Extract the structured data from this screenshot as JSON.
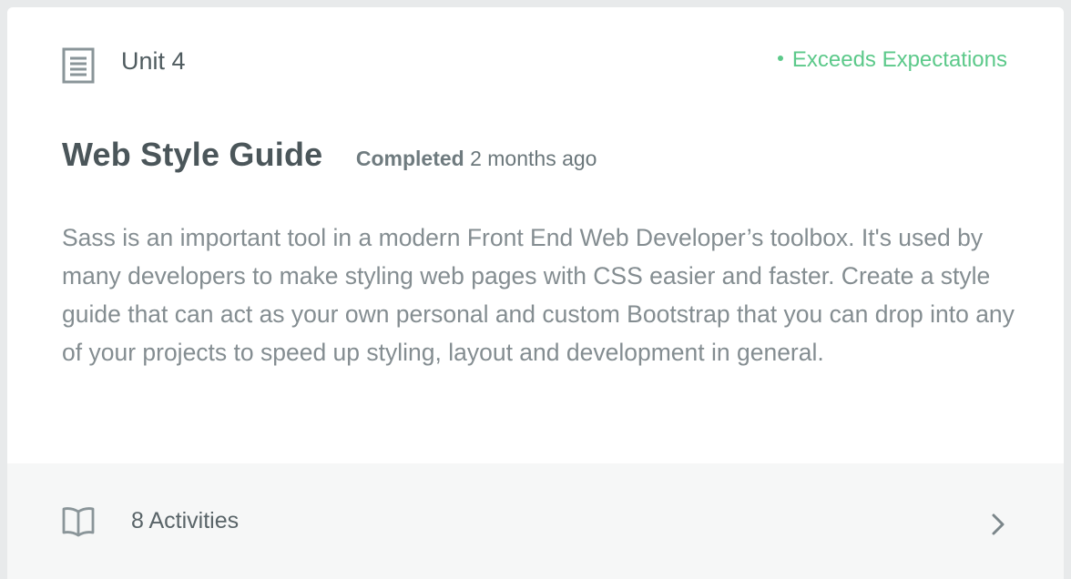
{
  "card": {
    "unit_label": "Unit 4",
    "status": "Exceeds Expectations",
    "status_color": "#5cc98a",
    "title": "Web Style Guide",
    "completed_label": "Completed",
    "completed_time": "2 months ago",
    "description": "Sass is an important tool in a modern Front End Web Developer’s toolbox. It's used by many developers to make styling web pages with CSS easier and faster. Create a style guide that can act as your own personal and custom Bootstrap that you can drop into any of your projects to speed up styling, layout and development in general.",
    "unit_icon": "document-icon"
  },
  "footer": {
    "activities_label": "8 Activities",
    "book_icon": "book-icon",
    "chevron_icon": "chevron-right-icon"
  }
}
